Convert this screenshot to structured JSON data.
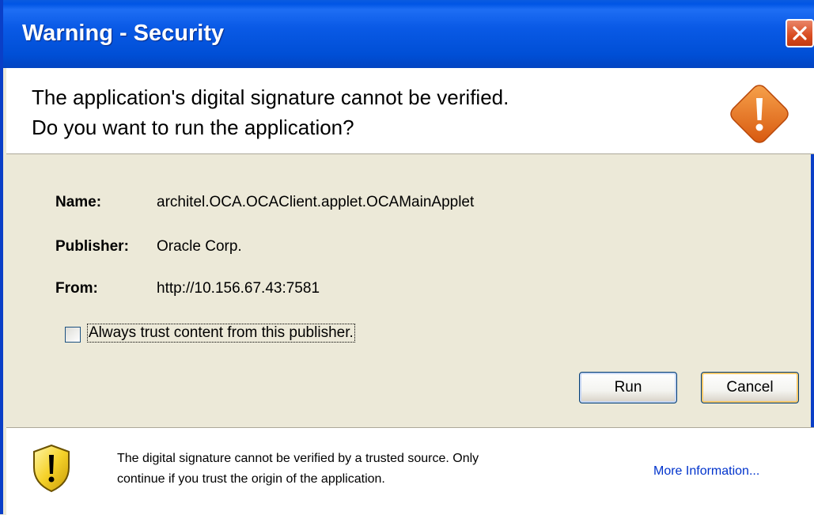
{
  "window": {
    "title": "Warning - Security"
  },
  "header": {
    "line1": "The application's digital signature cannot be verified.",
    "line2": "Do you want to run the application?"
  },
  "details": {
    "name_label": "Name:",
    "name_value": "architel.OCA.OCAClient.applet.OCAMainApplet",
    "publisher_label": "Publisher:",
    "publisher_value": "Oracle Corp.",
    "from_label": "From:",
    "from_value": "http://10.156.67.43:7581"
  },
  "checkbox": {
    "label": "Always trust content from this publisher.",
    "checked": false
  },
  "buttons": {
    "run": "Run",
    "cancel": "Cancel"
  },
  "footer": {
    "line1": "The digital signature cannot be verified by a trusted source.  Only",
    "line2": "continue if you trust the origin of the application.",
    "more_info": "More Information..."
  },
  "colors": {
    "titlebar": "#0054e3",
    "warning_orange": "#e8741c",
    "link": "#0033cc"
  }
}
